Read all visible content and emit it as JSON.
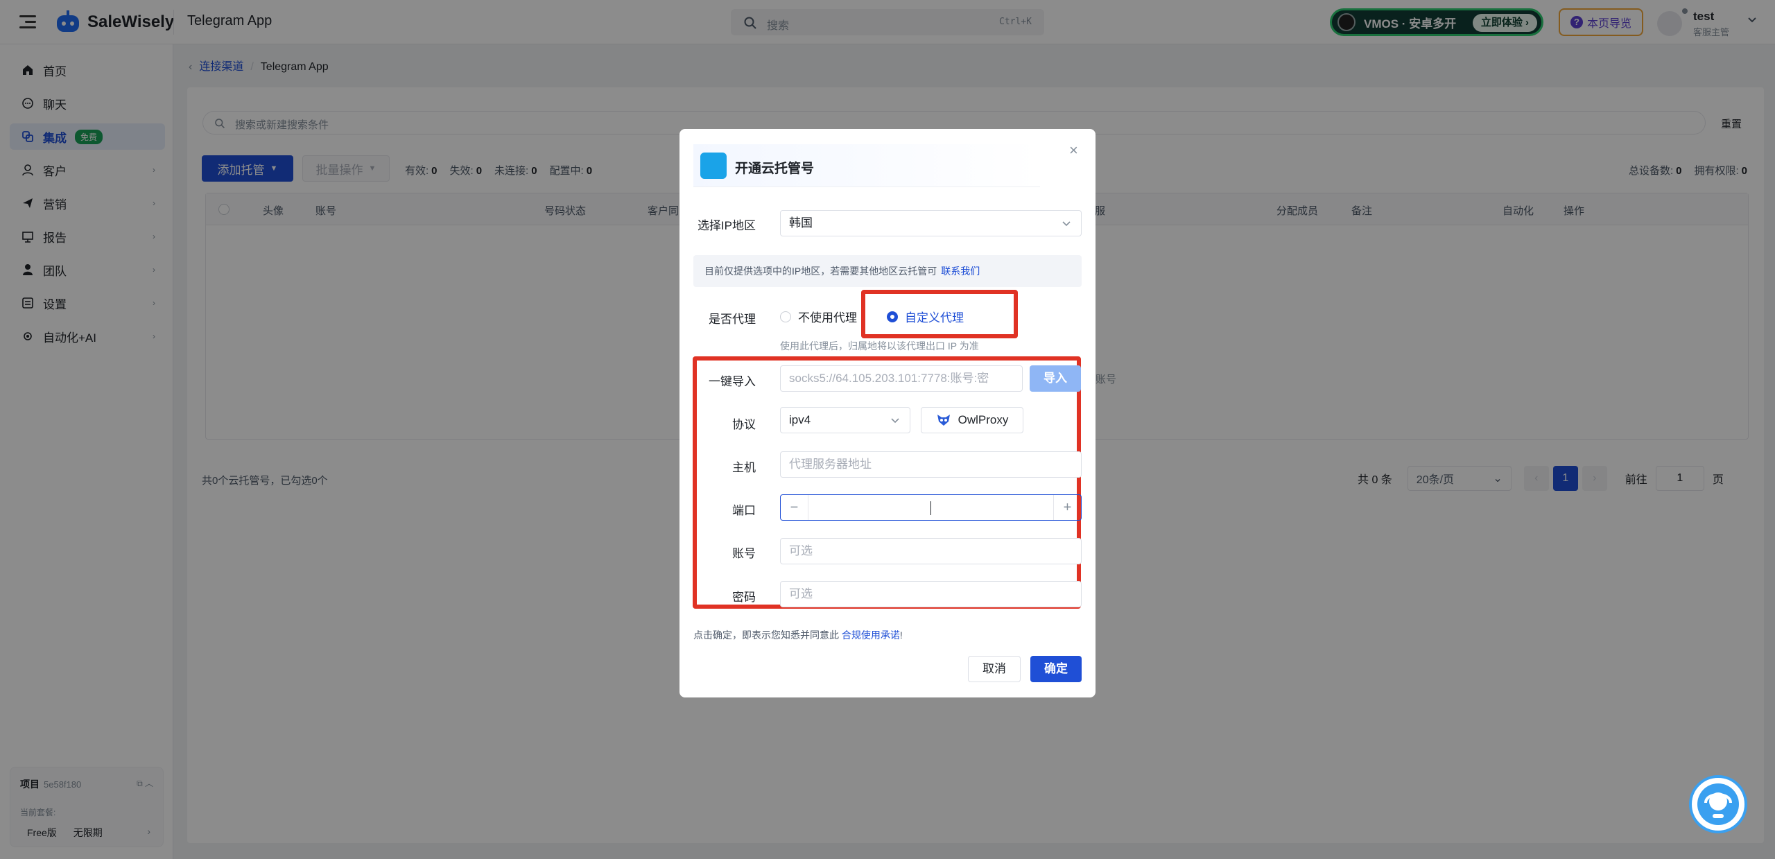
{
  "header": {
    "brand": "SaleWisely",
    "app_title": "Telegram App",
    "search_placeholder": "搜索",
    "search_shortcut": "Ctrl+K",
    "vmos_text": "VMOS · 安卓多开",
    "vmos_button": "立即体验",
    "guide_label": "本页导览",
    "user_name": "test",
    "user_role": "客服主管"
  },
  "sidebar": {
    "items": [
      {
        "label": "首页",
        "icon": "home-icon"
      },
      {
        "label": "聊天",
        "icon": "chat-icon"
      },
      {
        "label": "集成",
        "icon": "integration-icon",
        "badge": "免费"
      },
      {
        "label": "客户",
        "icon": "customer-icon"
      },
      {
        "label": "营销",
        "icon": "marketing-icon"
      },
      {
        "label": "报告",
        "icon": "report-icon"
      },
      {
        "label": "团队",
        "icon": "team-icon"
      },
      {
        "label": "设置",
        "icon": "settings-icon"
      },
      {
        "label": "自动化+AI",
        "icon": "automation-icon"
      }
    ],
    "project_label": "项目",
    "project_id": "5e58f180",
    "plan_label": "当前套餐:",
    "plan_name": "Free版",
    "plan_period": "无限期"
  },
  "breadcrumb": {
    "parent": "连接渠道",
    "current": "Telegram App"
  },
  "main": {
    "filter_placeholder": "搜索或新建搜索条件",
    "reset_label": "重置",
    "add_button": "添加托管",
    "batch_button": "批量操作",
    "stats": [
      {
        "label": "有效:",
        "value": "0"
      },
      {
        "label": "失效:",
        "value": "0"
      },
      {
        "label": "未连接:",
        "value": "0"
      },
      {
        "label": "配置中:",
        "value": "0"
      }
    ],
    "stats_right": [
      {
        "label": "总设备数:",
        "value": "0"
      },
      {
        "label": "拥有权限:",
        "value": "0"
      }
    ],
    "columns": [
      "头像",
      "账号",
      "号码状态",
      "客户同",
      "服",
      "分配成员",
      "备注",
      "自动化",
      "操作"
    ],
    "empty_fragment": "账号",
    "footer_text": "共0个云托管号，已勾选0个",
    "total_text": "共 0 条",
    "page_size": "20条/页",
    "current_page": "1",
    "goto_label": "前往",
    "goto_value": "1",
    "page_suffix": "页"
  },
  "modal": {
    "title": "开通云托管号",
    "region_label": "选择IP地区",
    "region_value": "韩国",
    "region_note": "目前仅提供选项中的IP地区，若需要其他地区云托管可",
    "contact_link": "联系我们",
    "proxy_label": "是否代理",
    "proxy_option_none": "不使用代理",
    "proxy_option_custom": "自定义代理",
    "proxy_hint": "使用此代理后，归属地将以该代理出口 IP 为准",
    "import_label": "一键导入",
    "import_placeholder": "socks5://64.105.203.101:7778:账号:密",
    "import_button": "导入",
    "protocol_label": "协议",
    "protocol_value": "ipv4",
    "owlproxy_label": "OwlProxy",
    "host_label": "主机",
    "host_placeholder": "代理服务器地址",
    "port_label": "端口",
    "account_label": "账号",
    "account_placeholder": "可选",
    "password_label": "密码",
    "password_placeholder": "可选",
    "agree_text": "点击确定，即表示您知悉并同意此",
    "agree_link": "合规使用承诺",
    "agree_suffix": "!",
    "cancel_button": "取消",
    "ok_button": "确定"
  },
  "colors": {
    "primary": "#1f4fd6",
    "highlight_red": "#e03224",
    "free_badge": "#18a058"
  }
}
